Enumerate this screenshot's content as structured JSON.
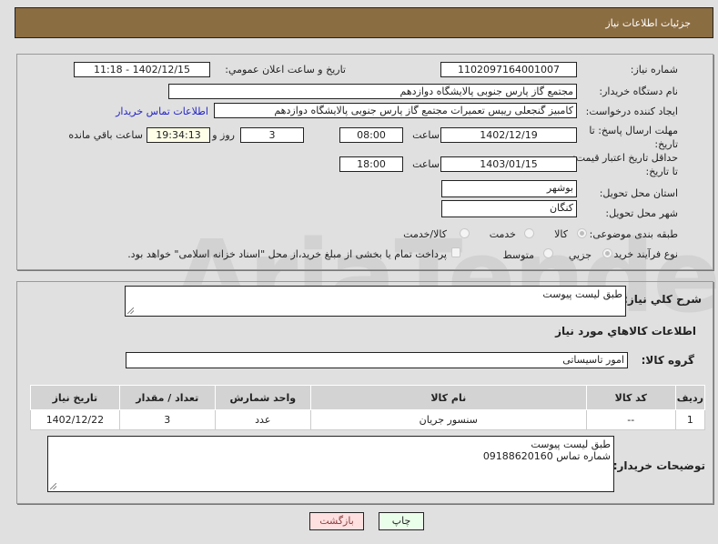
{
  "header": {
    "title": "جزئیات اطلاعات نیاز"
  },
  "form": {
    "need_number": {
      "label": "شماره نیاز:",
      "value": "1102097164001007"
    },
    "announce": {
      "label": "تاریخ و ساعت اعلان عمومي:",
      "value": "1402/12/15 - 11:18"
    },
    "buyer_org": {
      "label": "نام دستگاه خريدار:",
      "value": "مجتمع گاز پارس جنوبی  پالایشگاه دوازدهم"
    },
    "requester": {
      "label": "ایجاد کننده درخواست:",
      "value": "کامبیز گنجعلی رییس تعمیرات مجتمع گاز پارس جنوبی  پالایشگاه دوازدهم",
      "contact_link": "اطلاعات تماس خریدار"
    },
    "reply_deadline": {
      "label": "مهلت ارسال پاسخ: تا تاریخ:",
      "date": "1402/12/19",
      "time_label": "ساعت",
      "time": "08:00",
      "days": "3",
      "days_label": "روز و",
      "remaining": "19:34:13",
      "remaining_label": "ساعت باقي مانده"
    },
    "price_validity": {
      "label": "حداقل تاریخ اعتبار قیمت: تا تاریخ:",
      "date": "1403/01/15",
      "time_label": "ساعت",
      "time": "18:00"
    },
    "province": {
      "label": "استان محل تحویل:",
      "value": "بوشهر"
    },
    "city": {
      "label": "شهر محل تحویل:",
      "value": "کنگان"
    },
    "category": {
      "label": "طبقه بندی موضوعی:",
      "options": [
        "کالا",
        "خدمت",
        "کالا/خدمت"
      ],
      "selected": "کالا"
    },
    "process": {
      "label": "نوع فرآیند خرید :",
      "options": [
        "جزیي",
        "متوسط"
      ],
      "selected": "جزیي",
      "treasury_note": "پرداخت تمام یا بخشی از مبلغ خرید،از محل \"اسناد خزانه اسلامی\" خواهد بود."
    }
  },
  "details": {
    "summary_label": "شرح کلي نياز:",
    "summary_value": "طبق لیست پیوست",
    "items_title": "اطلاعات کالاهاي مورد نياز",
    "group_label": "گروه کالا:",
    "group_value": "امور تاسیساتی",
    "table": {
      "headers": [
        "رديف",
        "کد کالا",
        "نام کالا",
        "واحد شمارش",
        "تعداد / مقدار",
        "تاريخ نياز"
      ],
      "rows": [
        [
          "1",
          "--",
          "سنسور جریان",
          "عدد",
          "3",
          "1402/12/22"
        ]
      ]
    },
    "buyer_notes_label": "توضيحات خريدار:",
    "buyer_notes_line1": "طبق لیست پیوست",
    "buyer_notes_line2": "شماره تماس 09188620160"
  },
  "buttons": {
    "print": "چاپ",
    "back": "بازگشت"
  },
  "watermark": "AriaTender.neT"
}
